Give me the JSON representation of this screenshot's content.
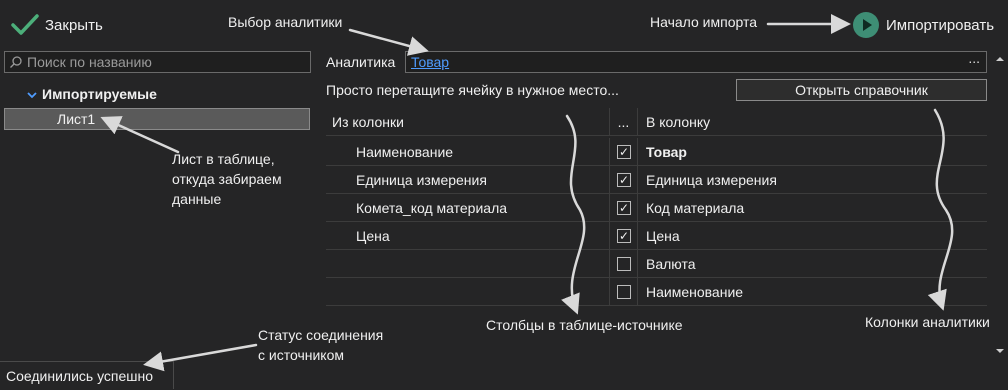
{
  "toolbar": {
    "close_label": "Закрыть",
    "import_label": "Импортировать"
  },
  "search": {
    "placeholder": "Поиск по названию"
  },
  "tree": {
    "node_label": "Импортируемые",
    "items": [
      "Лист1"
    ]
  },
  "status": {
    "text": "Соединились успешно"
  },
  "analytics": {
    "label": "Аналитика",
    "value": "Товар",
    "more_label": "..."
  },
  "hint": {
    "drag_text": "Просто перетащите ячейку в нужное место..."
  },
  "reference_button": {
    "label": "Открыть справочник"
  },
  "grid": {
    "headers": {
      "from": "Из колонки",
      "check": "...",
      "to": "В колонку"
    },
    "rows": [
      {
        "from": "Наименование",
        "checked": true,
        "to": "Товар",
        "bold": true
      },
      {
        "from": "Единица измерения",
        "checked": true,
        "to": "Единица измерения",
        "bold": false
      },
      {
        "from": "Комета_код материала",
        "checked": true,
        "to": "Код материала",
        "bold": false
      },
      {
        "from": "Цена",
        "checked": true,
        "to": "Цена",
        "bold": false
      },
      {
        "from": "",
        "checked": false,
        "to": "Валюта",
        "bold": false
      },
      {
        "from": "",
        "checked": false,
        "to": "Наименование",
        "bold": false
      }
    ]
  },
  "annotations": {
    "analytics_choice": "Выбор аналитики",
    "import_start": "Начало импорта",
    "sheet_note": [
      "Лист в таблице,",
      "откуда забираем",
      "данные"
    ],
    "source_columns": "Столбцы в таблице-источнике",
    "analytics_columns": "Колонки аналитики",
    "connection_status": [
      "Статус соединения",
      "с источником"
    ]
  },
  "colors": {
    "background": "#252526",
    "accent_check": "#4caf7a",
    "import_circle": "#3e8e75",
    "link": "#4f9cff"
  },
  "icons": {
    "close": "check-icon",
    "import": "play-icon",
    "search": "search-icon",
    "tree_toggle": "chevron-down-icon"
  }
}
